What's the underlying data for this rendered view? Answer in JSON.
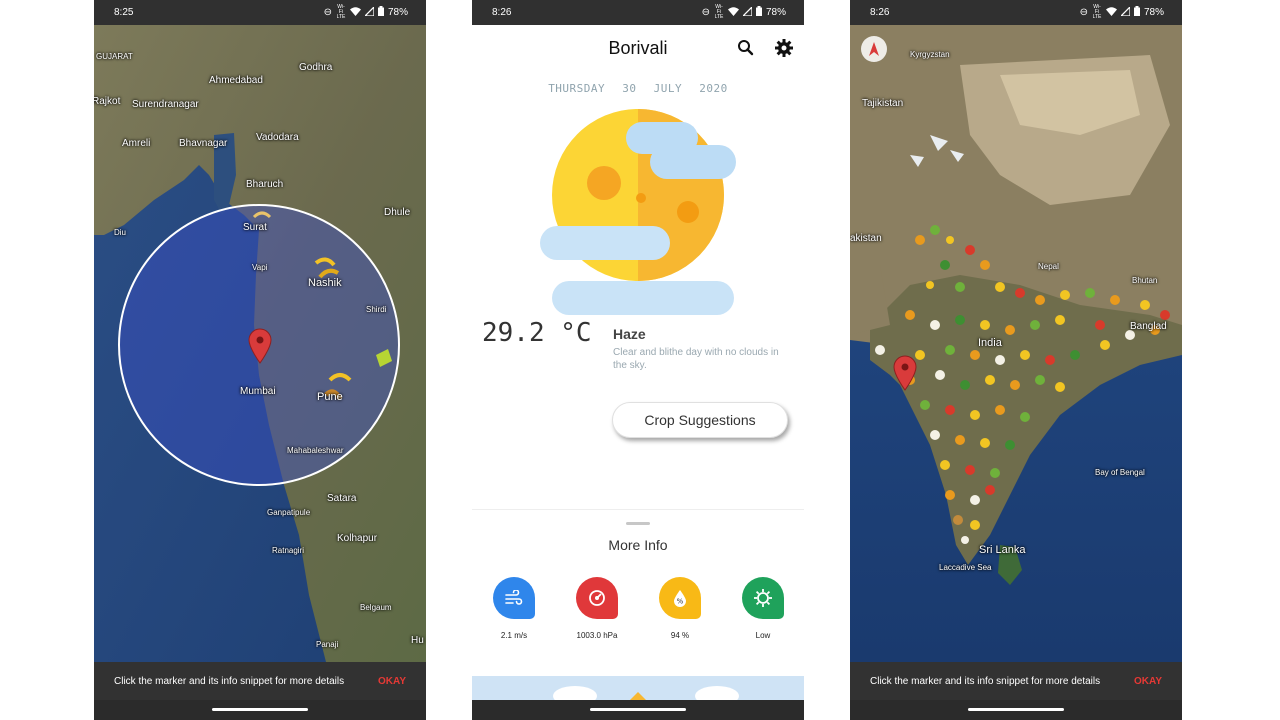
{
  "phone_left": {
    "status": {
      "time": "8:25",
      "battery": "78%",
      "network_small": "Wi-Fi\nLTE"
    },
    "map_labels": [
      "GUJARAT",
      "Ahmedabad",
      "Godhra",
      "Rajkot",
      "Surendranagar",
      "Vadodara",
      "Amreli",
      "Bhavnagar",
      "Bharuch",
      "Dhule",
      "Diu",
      "Surat",
      "Vapi",
      "Nashik",
      "Shirdi",
      "Mumbai",
      "Pune",
      "Mahabaleshwar",
      "Satara",
      "Ganpatipule",
      "Kolhapur",
      "Ratnagiri",
      "Belgaum",
      "Panaji",
      "Hu"
    ],
    "snackbar": {
      "message": "Click the marker and its info snippet for more details",
      "action": "OKAY"
    }
  },
  "phone_center": {
    "status": {
      "time": "8:26",
      "battery": "78%",
      "network_small": "Wi-Fi\nLTE"
    },
    "city": "Borivali",
    "date": {
      "weekday": "THURSDAY",
      "day": "30",
      "month": "JULY",
      "year": "2020"
    },
    "temperature": "29.2 °C",
    "condition": "Haze",
    "description": "Clear and blithe day with no clouds in the sky.",
    "crop_button": "Crop Suggestions",
    "more_info_title": "More Info",
    "stats": [
      {
        "icon": "wind-icon",
        "value": "2.1 m/s",
        "color": "#2f86eb"
      },
      {
        "icon": "pressure-icon",
        "value": "1003.0 hPa",
        "color": "#e0383a"
      },
      {
        "icon": "humidity-icon",
        "value": "94 %",
        "color": "#f8b916"
      },
      {
        "icon": "uv-icon",
        "value": "Low",
        "color": "#1fa25b"
      }
    ]
  },
  "phone_right": {
    "status": {
      "time": "8:26",
      "battery": "78%",
      "network_small": "Wi-Fi\nLTE"
    },
    "map_labels": [
      "Kyrgyzstan",
      "Tajikistan",
      "akistan",
      "Nepal",
      "Bhutan",
      "Banglad",
      "India",
      "Bay of Bengal",
      "Sri Lanka",
      "Laccadive Sea"
    ],
    "snackbar": {
      "message": "Click the marker and its info snippet for more details",
      "action": "OKAY"
    }
  },
  "colors": {
    "accent_red": "#e53935",
    "status_bg": "#303030",
    "snackbar_bg": "#323232"
  }
}
